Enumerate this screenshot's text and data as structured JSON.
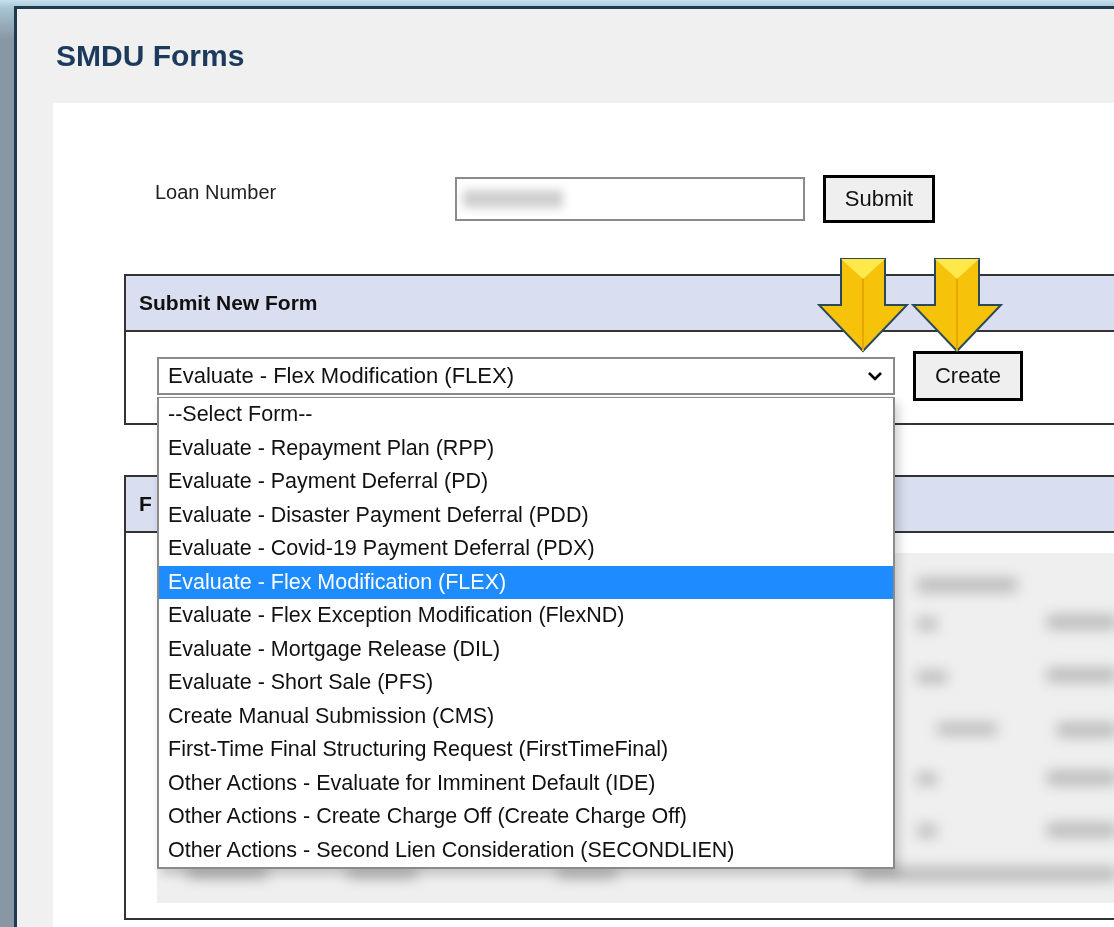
{
  "page": {
    "title": "SMDU Forms"
  },
  "loan_lookup": {
    "label": "Loan Number",
    "submit_button": "Submit"
  },
  "submit_new_form": {
    "title": "Submit New Form",
    "select": {
      "value": "Evaluate - Flex Modification (FLEX)",
      "expanded": true,
      "options": [
        {
          "label": "--Select Form--",
          "selected": false
        },
        {
          "label": "Evaluate - Repayment Plan (RPP)",
          "selected": false
        },
        {
          "label": "Evaluate - Payment Deferral (PD)",
          "selected": false
        },
        {
          "label": "Evaluate - Disaster Payment Deferral (PDD)",
          "selected": false
        },
        {
          "label": "Evaluate - Covid-19 Payment Deferral (PDX)",
          "selected": false
        },
        {
          "label": "Evaluate - Flex Modification (FLEX)",
          "selected": true
        },
        {
          "label": "Evaluate - Flex Exception Modification (FlexND)",
          "selected": false
        },
        {
          "label": "Evaluate - Mortgage Release (DIL)",
          "selected": false
        },
        {
          "label": "Evaluate - Short Sale (PFS)",
          "selected": false
        },
        {
          "label": "Create Manual Submission (CMS)",
          "selected": false
        },
        {
          "label": "First-Time Final Structuring Request (FirstTimeFinal)",
          "selected": false
        },
        {
          "label": "Other Actions - Evaluate for Imminent Default (IDE)",
          "selected": false
        },
        {
          "label": "Other Actions - Create Charge Off (Create Charge Off)",
          "selected": false
        },
        {
          "label": "Other Actions - Second Lien Consideration (SECONDLIEN)",
          "selected": false
        }
      ]
    },
    "create_button": "Create"
  },
  "forms_panel": {
    "title": "F"
  }
}
